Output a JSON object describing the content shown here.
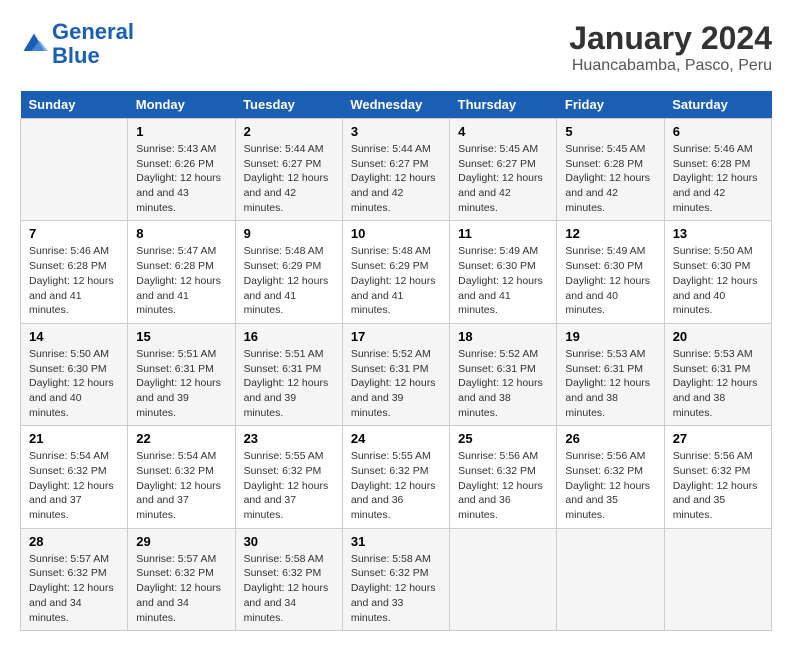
{
  "header": {
    "logo_line1": "General",
    "logo_line2": "Blue",
    "title": "January 2024",
    "subtitle": "Huancabamba, Pasco, Peru"
  },
  "weekdays": [
    "Sunday",
    "Monday",
    "Tuesday",
    "Wednesday",
    "Thursday",
    "Friday",
    "Saturday"
  ],
  "weeks": [
    [
      {
        "day": "",
        "sunrise": "",
        "sunset": "",
        "daylight": ""
      },
      {
        "day": "1",
        "sunrise": "Sunrise: 5:43 AM",
        "sunset": "Sunset: 6:26 PM",
        "daylight": "Daylight: 12 hours and 43 minutes."
      },
      {
        "day": "2",
        "sunrise": "Sunrise: 5:44 AM",
        "sunset": "Sunset: 6:27 PM",
        "daylight": "Daylight: 12 hours and 42 minutes."
      },
      {
        "day": "3",
        "sunrise": "Sunrise: 5:44 AM",
        "sunset": "Sunset: 6:27 PM",
        "daylight": "Daylight: 12 hours and 42 minutes."
      },
      {
        "day": "4",
        "sunrise": "Sunrise: 5:45 AM",
        "sunset": "Sunset: 6:27 PM",
        "daylight": "Daylight: 12 hours and 42 minutes."
      },
      {
        "day": "5",
        "sunrise": "Sunrise: 5:45 AM",
        "sunset": "Sunset: 6:28 PM",
        "daylight": "Daylight: 12 hours and 42 minutes."
      },
      {
        "day": "6",
        "sunrise": "Sunrise: 5:46 AM",
        "sunset": "Sunset: 6:28 PM",
        "daylight": "Daylight: 12 hours and 42 minutes."
      }
    ],
    [
      {
        "day": "7",
        "sunrise": "Sunrise: 5:46 AM",
        "sunset": "Sunset: 6:28 PM",
        "daylight": "Daylight: 12 hours and 41 minutes."
      },
      {
        "day": "8",
        "sunrise": "Sunrise: 5:47 AM",
        "sunset": "Sunset: 6:28 PM",
        "daylight": "Daylight: 12 hours and 41 minutes."
      },
      {
        "day": "9",
        "sunrise": "Sunrise: 5:48 AM",
        "sunset": "Sunset: 6:29 PM",
        "daylight": "Daylight: 12 hours and 41 minutes."
      },
      {
        "day": "10",
        "sunrise": "Sunrise: 5:48 AM",
        "sunset": "Sunset: 6:29 PM",
        "daylight": "Daylight: 12 hours and 41 minutes."
      },
      {
        "day": "11",
        "sunrise": "Sunrise: 5:49 AM",
        "sunset": "Sunset: 6:30 PM",
        "daylight": "Daylight: 12 hours and 41 minutes."
      },
      {
        "day": "12",
        "sunrise": "Sunrise: 5:49 AM",
        "sunset": "Sunset: 6:30 PM",
        "daylight": "Daylight: 12 hours and 40 minutes."
      },
      {
        "day": "13",
        "sunrise": "Sunrise: 5:50 AM",
        "sunset": "Sunset: 6:30 PM",
        "daylight": "Daylight: 12 hours and 40 minutes."
      }
    ],
    [
      {
        "day": "14",
        "sunrise": "Sunrise: 5:50 AM",
        "sunset": "Sunset: 6:30 PM",
        "daylight": "Daylight: 12 hours and 40 minutes."
      },
      {
        "day": "15",
        "sunrise": "Sunrise: 5:51 AM",
        "sunset": "Sunset: 6:31 PM",
        "daylight": "Daylight: 12 hours and 39 minutes."
      },
      {
        "day": "16",
        "sunrise": "Sunrise: 5:51 AM",
        "sunset": "Sunset: 6:31 PM",
        "daylight": "Daylight: 12 hours and 39 minutes."
      },
      {
        "day": "17",
        "sunrise": "Sunrise: 5:52 AM",
        "sunset": "Sunset: 6:31 PM",
        "daylight": "Daylight: 12 hours and 39 minutes."
      },
      {
        "day": "18",
        "sunrise": "Sunrise: 5:52 AM",
        "sunset": "Sunset: 6:31 PM",
        "daylight": "Daylight: 12 hours and 38 minutes."
      },
      {
        "day": "19",
        "sunrise": "Sunrise: 5:53 AM",
        "sunset": "Sunset: 6:31 PM",
        "daylight": "Daylight: 12 hours and 38 minutes."
      },
      {
        "day": "20",
        "sunrise": "Sunrise: 5:53 AM",
        "sunset": "Sunset: 6:31 PM",
        "daylight": "Daylight: 12 hours and 38 minutes."
      }
    ],
    [
      {
        "day": "21",
        "sunrise": "Sunrise: 5:54 AM",
        "sunset": "Sunset: 6:32 PM",
        "daylight": "Daylight: 12 hours and 37 minutes."
      },
      {
        "day": "22",
        "sunrise": "Sunrise: 5:54 AM",
        "sunset": "Sunset: 6:32 PM",
        "daylight": "Daylight: 12 hours and 37 minutes."
      },
      {
        "day": "23",
        "sunrise": "Sunrise: 5:55 AM",
        "sunset": "Sunset: 6:32 PM",
        "daylight": "Daylight: 12 hours and 37 minutes."
      },
      {
        "day": "24",
        "sunrise": "Sunrise: 5:55 AM",
        "sunset": "Sunset: 6:32 PM",
        "daylight": "Daylight: 12 hours and 36 minutes."
      },
      {
        "day": "25",
        "sunrise": "Sunrise: 5:56 AM",
        "sunset": "Sunset: 6:32 PM",
        "daylight": "Daylight: 12 hours and 36 minutes."
      },
      {
        "day": "26",
        "sunrise": "Sunrise: 5:56 AM",
        "sunset": "Sunset: 6:32 PM",
        "daylight": "Daylight: 12 hours and 35 minutes."
      },
      {
        "day": "27",
        "sunrise": "Sunrise: 5:56 AM",
        "sunset": "Sunset: 6:32 PM",
        "daylight": "Daylight: 12 hours and 35 minutes."
      }
    ],
    [
      {
        "day": "28",
        "sunrise": "Sunrise: 5:57 AM",
        "sunset": "Sunset: 6:32 PM",
        "daylight": "Daylight: 12 hours and 34 minutes."
      },
      {
        "day": "29",
        "sunrise": "Sunrise: 5:57 AM",
        "sunset": "Sunset: 6:32 PM",
        "daylight": "Daylight: 12 hours and 34 minutes."
      },
      {
        "day": "30",
        "sunrise": "Sunrise: 5:58 AM",
        "sunset": "Sunset: 6:32 PM",
        "daylight": "Daylight: 12 hours and 34 minutes."
      },
      {
        "day": "31",
        "sunrise": "Sunrise: 5:58 AM",
        "sunset": "Sunset: 6:32 PM",
        "daylight": "Daylight: 12 hours and 33 minutes."
      },
      {
        "day": "",
        "sunrise": "",
        "sunset": "",
        "daylight": ""
      },
      {
        "day": "",
        "sunrise": "",
        "sunset": "",
        "daylight": ""
      },
      {
        "day": "",
        "sunrise": "",
        "sunset": "",
        "daylight": ""
      }
    ]
  ]
}
